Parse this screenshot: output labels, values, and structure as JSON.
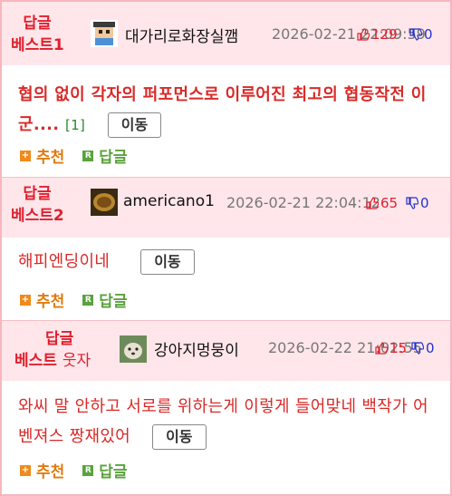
{
  "posts": [
    {
      "badge_line1": "답글",
      "badge_line2": "베스트1",
      "nickname": "대가리로화장실깸",
      "date": "2026-02-21 22:09:59",
      "up_count": "129",
      "down_count": "0",
      "text": "협의 없이 각자의 퍼포먼스로 이루어진 최고의 협동작전 이군....",
      "comment_count": "[1]",
      "move_label": "이동",
      "recommend_label": "추천",
      "reply_label": "답글"
    },
    {
      "badge_line1": "답글",
      "badge_line2": "베스트2",
      "nickname": "americano1",
      "date": "2026-02-21 22:04:12",
      "up_count": "65",
      "down_count": "0",
      "text": "해피엔딩이네",
      "move_label": "이동",
      "recommend_label": "추천",
      "reply_label": "답글"
    },
    {
      "badge_line1": "답글",
      "badge_line2": "베스트",
      "badge_tag": "웃자",
      "nickname": "강아지멍뭉이",
      "date": "2026-02-22 21:02:55",
      "up_count": "15",
      "down_count": "0",
      "text": "와씨 말 안하고 서로를 위하는게 이렇게 들어맞네 백작가 어벤져스 짱재있어",
      "move_label": "이동",
      "recommend_label": "추천",
      "reply_label": "답글"
    }
  ],
  "colors": {
    "header_bg": "#ffe6ea",
    "border": "#f7b6bd",
    "badge_red": "#e0202e",
    "up_red": "#e0202e",
    "down_blue": "#2233cc",
    "recommend_orange": "#e07b10",
    "reply_green": "#5aa23c"
  }
}
